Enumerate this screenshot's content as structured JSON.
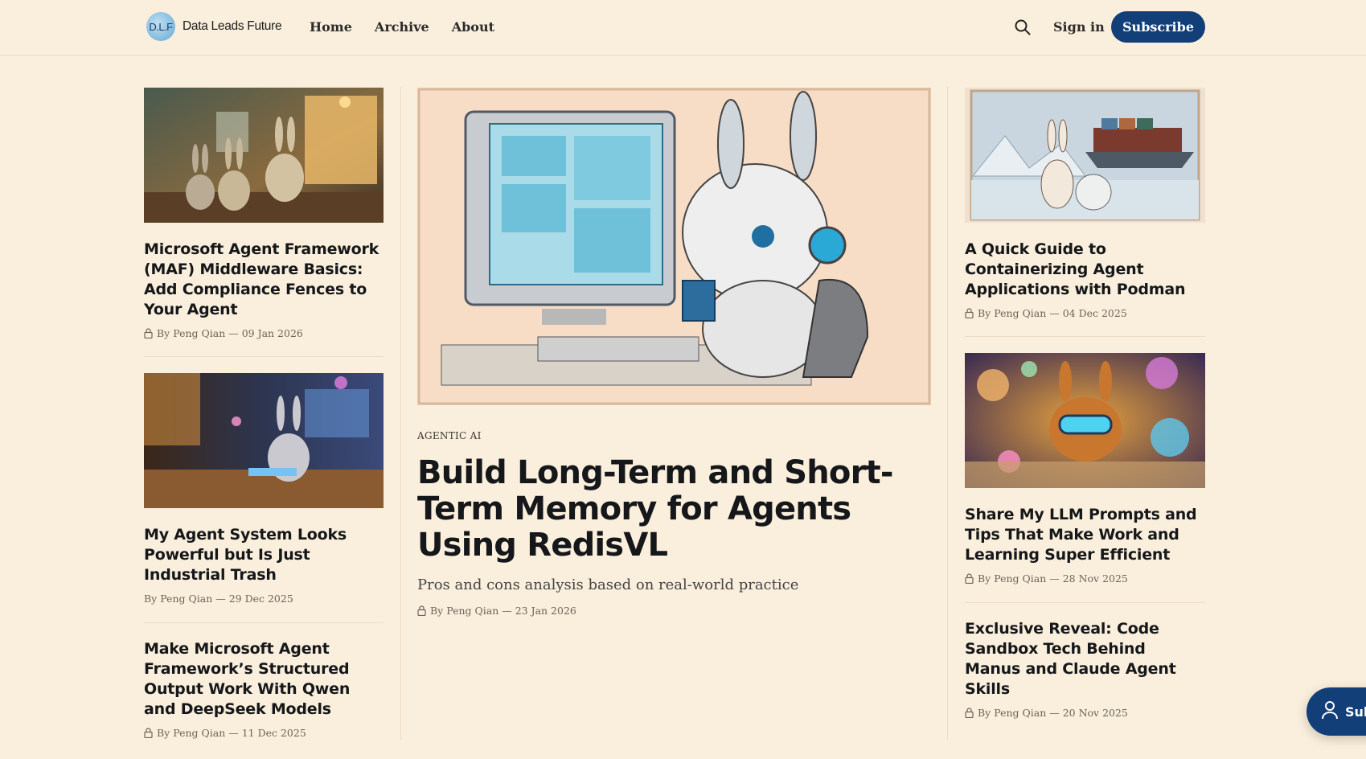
{
  "header": {
    "logo_badge": "D.L.F",
    "site_name": "Data Leads Future",
    "nav": [
      "Home",
      "Archive",
      "About"
    ],
    "sign_in": "Sign in",
    "subscribe": "Subscribe"
  },
  "left_posts": [
    {
      "title": "Microsoft Agent Framework (MAF) Middleware Basics: Add Compliance Fences to Your Agent",
      "meta": "By Peng Qian — 09 Jan 2026",
      "locked": true,
      "image": "bunnies-workshop-illustration"
    },
    {
      "title": "My Agent System Looks Powerful but Is Just Industrial Trash",
      "meta": "By Peng Qian — 29 Dec 2025",
      "locked": false,
      "image": "bunny-desk-hologram-illustration"
    },
    {
      "title": "Make Microsoft Agent Framework’s Structured Output Work With Qwen and DeepSeek Models",
      "meta": "By Peng Qian — 11 Dec 2025",
      "locked": true
    }
  ],
  "featured": {
    "tag": "AGENTIC AI",
    "title": "Build Long-Term and Short-Term Memory for Agents Using RedisVL",
    "excerpt": "Pros and cons analysis based on real-world practice",
    "meta": "By Peng Qian — 23 Jan 2026",
    "image": "robot-bunny-computer-illustration"
  },
  "right_posts": [
    {
      "title": "A Quick Guide to Containerizing Agent Applications with Podman",
      "meta": "By Peng Qian — 04 Dec 2025",
      "locked": true,
      "image": "bunny-seal-container-ship-illustration"
    },
    {
      "title": "Share My LLM Prompts and Tips That Make Work and Learning Super Efficient",
      "meta": "By Peng Qian — 28 Nov 2025",
      "locked": true,
      "image": "bunny-headphones-bubbles-illustration"
    },
    {
      "title": "Exclusive Reveal: Code Sandbox Tech Behind Manus and Claude Agent Skills",
      "meta": "By Peng Qian — 20 Nov 2025",
      "locked": true
    }
  ],
  "portal_button": {
    "label": "Sub",
    "icon": "user-icon"
  },
  "colors": {
    "background": "#faefdc",
    "accent": "#123f78"
  }
}
